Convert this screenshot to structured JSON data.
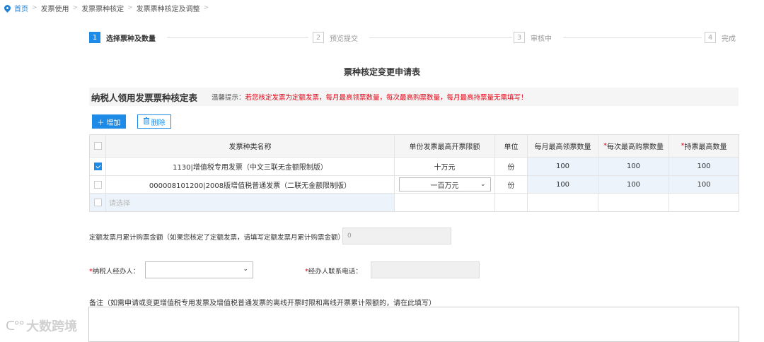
{
  "breadcrumb": {
    "home": "首页",
    "items": [
      "发票使用",
      "发票票种核定",
      "发票票种核定及调整"
    ],
    "separator": ">"
  },
  "steps": [
    {
      "num": "1",
      "label": "选择票种及数量",
      "active": true
    },
    {
      "num": "2",
      "label": "预览提交",
      "active": false
    },
    {
      "num": "3",
      "label": "审核中",
      "active": false
    },
    {
      "num": "4",
      "label": "完成",
      "active": false
    }
  ],
  "form_title": "票种核定变更申请表",
  "section": {
    "title": "纳税人领用发票票种核定表",
    "tip_label": "温馨提示：",
    "tip_text": "若您核定发票为定额发票，每月最高领票数量，每次最高购票数量，每月最高持票量无需填写！"
  },
  "toolbar": {
    "add_label": "增加",
    "add_icon": "plus-icon",
    "delete_label": "删除",
    "delete_icon": "trash-icon"
  },
  "table": {
    "headers": {
      "name": "发票种类名称",
      "limit": "单份发票最高开票限额",
      "unit": "单位",
      "monthly_max": "每月最高领票数量",
      "per_purchase_max": "每次最高购票数量",
      "holding_max": "持票最高数量",
      "required_mark": "*"
    },
    "rows": [
      {
        "checked": true,
        "name": "1130|增值税专用发票（中文三联无金额限制版）",
        "limit": "十万元",
        "unit": "份",
        "monthly_max": "100",
        "per_purchase_max": "100",
        "holding_max": "100"
      },
      {
        "checked": false,
        "name": "000008101200|2008版增值税普通发票（二联无金额限制版）",
        "limit": "一百万元",
        "unit": "份",
        "monthly_max": "100",
        "per_purchase_max": "100",
        "holding_max": "100"
      }
    ],
    "empty_row_placeholder": "请选择"
  },
  "fields": {
    "quota_label": "定额发票月累计购票金额（如果您核定了定额发票，请填写定额发票月累计购票金额）：",
    "quota_value": "0",
    "agent_label": "纳税人经办人：",
    "agent_value": "",
    "phone_label": "经办人联系电话：",
    "phone_value": "",
    "required_mark": "*"
  },
  "remarks_label": "备注（如需申请或变更增值税专用发票及增值税普通发票的离线开票时限和离线开票累计限额的，请在此填写）",
  "watermark": "大数跨境",
  "colors": {
    "accent": "#1e8be6",
    "warning": "#e60012",
    "header_bg": "#f5f5f5",
    "highlight": "#ecf3fb"
  }
}
